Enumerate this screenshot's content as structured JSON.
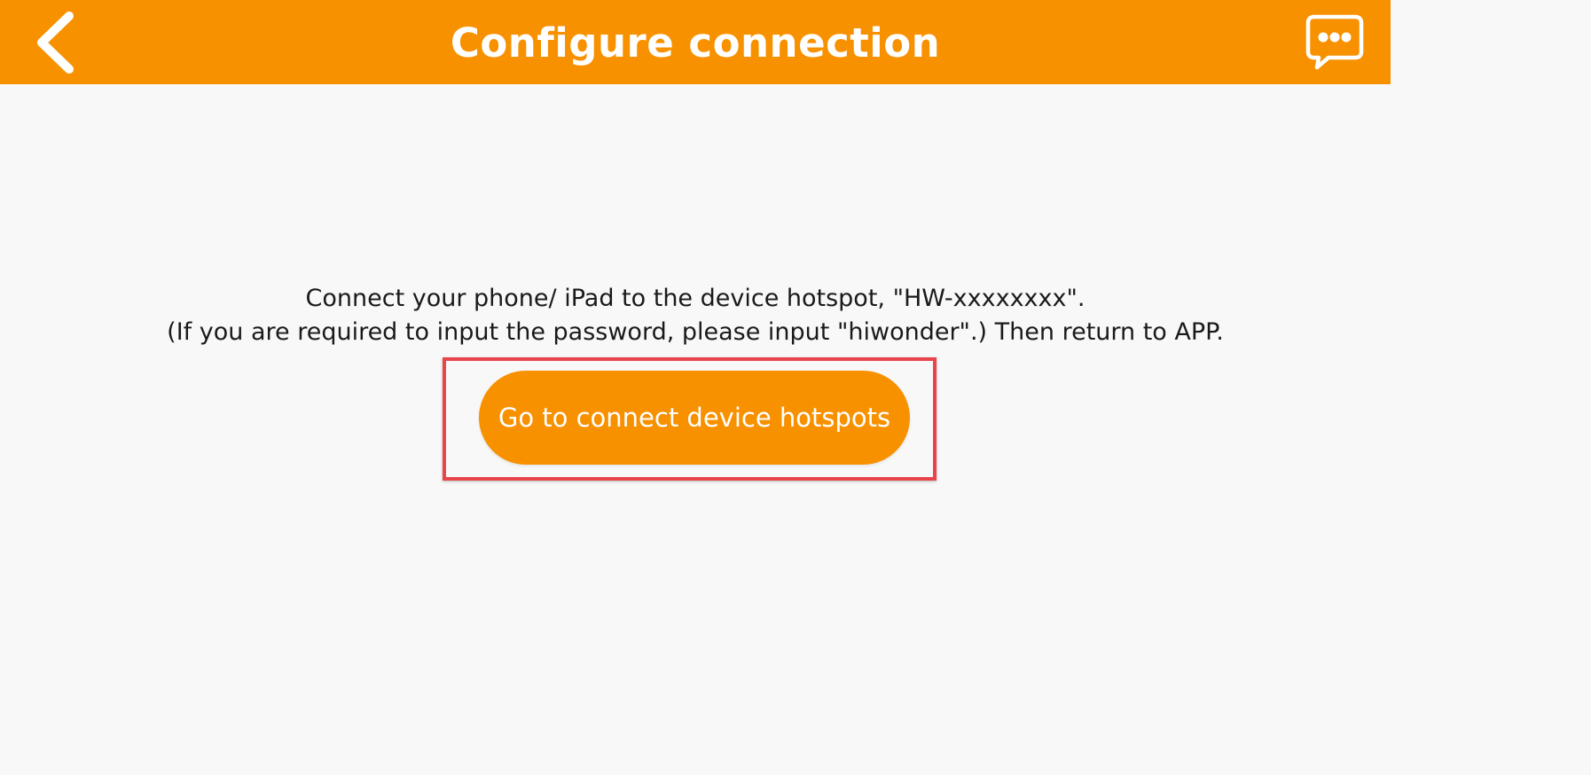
{
  "header": {
    "title": "Configure connection",
    "back_icon": "chevron-left-icon",
    "chat_icon": "chat-bubble-icon",
    "color": "#f89100"
  },
  "main": {
    "instruction_line_1": "Connect your phone/ iPad to the device hotspot, \"HW-xxxxxxxx\".",
    "instruction_line_2": "(If you are required to input the password, please input \"hiwonder\".) Then return to APP.",
    "connect_button_label": "Go to connect device hotspots",
    "highlight_color": "#e8454b"
  }
}
